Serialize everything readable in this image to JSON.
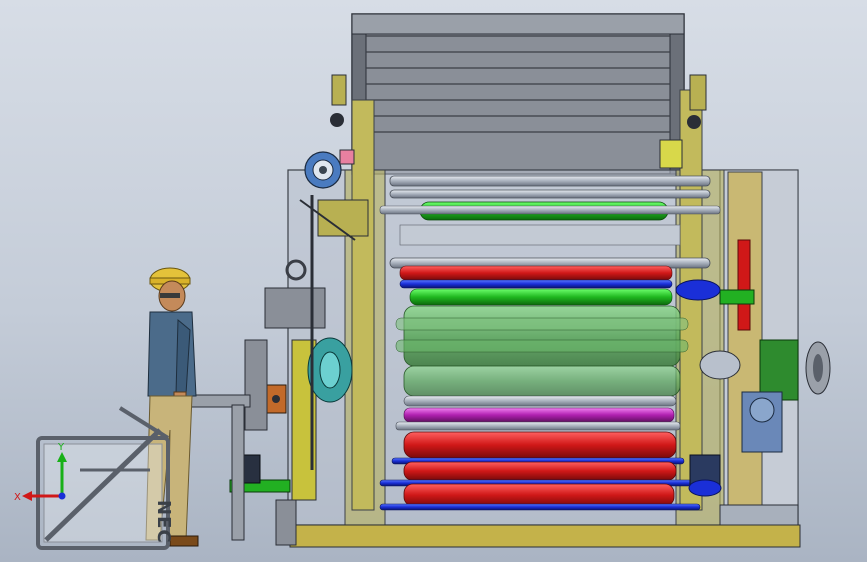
{
  "viewport": {
    "axis_triad": {
      "x_label": "X",
      "y_label": "Y"
    },
    "logo": {
      "text": "NEC"
    }
  },
  "colors": {
    "background_top": "#d7dde6",
    "background_bottom": "#aab4c3",
    "frame_yellow": "#b8b052",
    "roll_green": "#22c022",
    "roll_red": "#d01818",
    "roll_blue": "#1a2fd8",
    "roll_magenta": "#c020c0",
    "drive_green": "#2e8b2e",
    "triad_x": "#d01818",
    "triad_y": "#18b018",
    "triad_z": "#1a2fd8"
  }
}
